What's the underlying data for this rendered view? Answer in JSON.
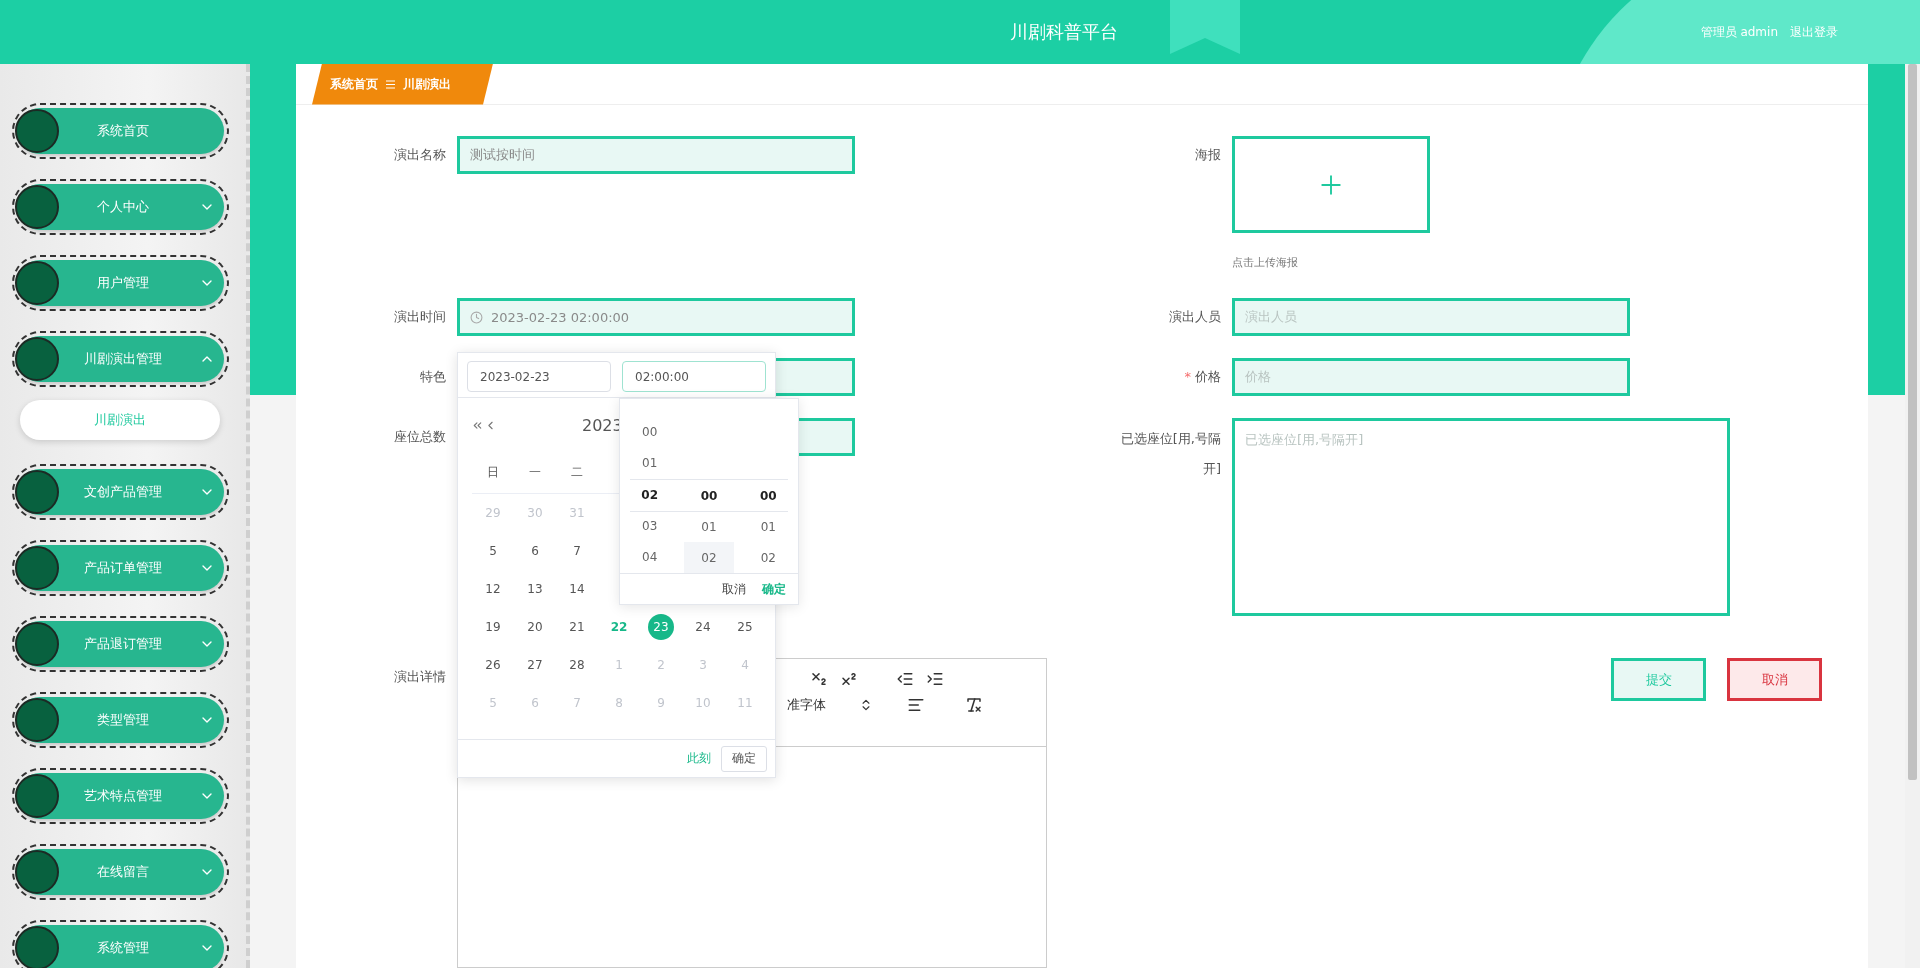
{
  "header": {
    "title": "川剧科普平台",
    "user": "管理员 admin",
    "logout": "退出登录"
  },
  "sidebar": {
    "items": [
      {
        "label": "系统首页",
        "kind": "link"
      },
      {
        "label": "个人中心",
        "kind": "group",
        "expanded": false
      },
      {
        "label": "用户管理",
        "kind": "group",
        "expanded": false
      },
      {
        "label": "川剧演出管理",
        "kind": "group",
        "expanded": true,
        "children": [
          {
            "label": "川剧演出",
            "selected": true
          }
        ]
      },
      {
        "label": "文创产品管理",
        "kind": "group",
        "expanded": false
      },
      {
        "label": "产品订单管理",
        "kind": "group",
        "expanded": false
      },
      {
        "label": "产品退订管理",
        "kind": "group",
        "expanded": false
      },
      {
        "label": "类型管理",
        "kind": "group",
        "expanded": false
      },
      {
        "label": "艺术特点管理",
        "kind": "group",
        "expanded": false
      },
      {
        "label": "在线留言",
        "kind": "group",
        "expanded": false
      },
      {
        "label": "系统管理",
        "kind": "group",
        "expanded": false
      }
    ]
  },
  "breadcrumb": [
    "系统首页",
    "川剧演出"
  ],
  "form": {
    "left": [
      {
        "label": "演出名称",
        "kind": "input",
        "value": "测试按时间"
      },
      {
        "label": "演出时间",
        "kind": "datetime",
        "value": "2023-02-23 02:00:00"
      },
      {
        "label": "特色",
        "kind": "input"
      },
      {
        "label": "座位总数",
        "kind": "input"
      },
      {
        "label": "演出详情",
        "kind": "editor"
      }
    ],
    "right": [
      {
        "label": "海报",
        "kind": "upload",
        "hint": "点击上传海报",
        "required": false
      },
      {
        "label": "演出人员",
        "kind": "input",
        "placeholder": "演出人员",
        "required": false
      },
      {
        "label": "价格",
        "kind": "input",
        "placeholder": "价格",
        "required": true
      },
      {
        "label": "已选座位[用,号隔开]",
        "kind": "textarea",
        "placeholder": "已选座位[用,号隔开]",
        "required": false
      }
    ],
    "buttons": [
      {
        "label": "提交",
        "kind": "submit"
      },
      {
        "label": "取消",
        "kind": "cancel"
      }
    ],
    "editor_toolbar": {
      "font_select": "准字体"
    },
    "required_mark": "*"
  },
  "date_picker": {
    "date_input": "2023-02-23",
    "time_input": "02:00:00",
    "month_title": "2023",
    "weekdays": [
      "日",
      "一",
      "二"
    ],
    "weeks": [
      [
        {
          "day": "29",
          "muted": true,
          "today": false,
          "selected": false
        },
        {
          "day": "30",
          "muted": true,
          "today": false,
          "selected": false
        },
        {
          "day": "31",
          "muted": true,
          "today": false,
          "selected": false
        }
      ],
      [
        {
          "day": "5",
          "muted": false,
          "today": false,
          "selected": false
        },
        {
          "day": "6",
          "muted": false,
          "today": false,
          "selected": false
        },
        {
          "day": "7",
          "muted": false,
          "today": false,
          "selected": false
        }
      ],
      [
        {
          "day": "12",
          "muted": false,
          "today": false,
          "selected": false
        },
        {
          "day": "13",
          "muted": false,
          "today": false,
          "selected": false
        },
        {
          "day": "14",
          "muted": false,
          "today": false,
          "selected": false
        }
      ],
      [
        {
          "day": "19",
          "muted": false,
          "today": false,
          "selected": false
        },
        {
          "day": "20",
          "muted": false,
          "today": false,
          "selected": false
        },
        {
          "day": "21",
          "muted": false,
          "today": false,
          "selected": false
        },
        {
          "day": "22",
          "muted": false,
          "today": true,
          "selected": false
        },
        {
          "day": "23",
          "muted": false,
          "today": false,
          "selected": true
        },
        {
          "day": "24",
          "muted": false,
          "today": false,
          "selected": false
        },
        {
          "day": "25",
          "muted": false,
          "today": false,
          "selected": false
        }
      ],
      [
        {
          "day": "26",
          "muted": false,
          "today": false,
          "selected": false
        },
        {
          "day": "27",
          "muted": false,
          "today": false,
          "selected": false
        },
        {
          "day": "28",
          "muted": false,
          "today": false,
          "selected": false
        },
        {
          "day": "1",
          "muted": true,
          "today": false,
          "selected": false
        },
        {
          "day": "2",
          "muted": true,
          "today": false,
          "selected": false
        },
        {
          "day": "3",
          "muted": true,
          "today": false,
          "selected": false
        },
        {
          "day": "4",
          "muted": true,
          "today": false,
          "selected": false
        }
      ],
      [
        {
          "day": "5",
          "muted": true,
          "today": false,
          "selected": false
        },
        {
          "day": "6",
          "muted": true,
          "today": false,
          "selected": false
        },
        {
          "day": "7",
          "muted": true,
          "today": false,
          "selected": false
        },
        {
          "day": "8",
          "muted": true,
          "today": false,
          "selected": false
        },
        {
          "day": "9",
          "muted": true,
          "today": false,
          "selected": false
        },
        {
          "day": "10",
          "muted": true,
          "today": false,
          "selected": false
        },
        {
          "day": "11",
          "muted": true,
          "today": false,
          "selected": false
        }
      ]
    ],
    "now_link": "此刻",
    "confirm": "确定",
    "time_panel": {
      "columns": [
        [
          {
            "text": "00",
            "selected": false,
            "hovered": false
          },
          {
            "text": "01",
            "selected": false,
            "hovered": false
          },
          {
            "text": "02",
            "selected": true,
            "hovered": false
          },
          {
            "text": "03",
            "selected": false,
            "hovered": false
          },
          {
            "text": "04",
            "selected": false,
            "hovered": false
          }
        ],
        [
          {
            "text": "00",
            "selected": true,
            "hovered": false
          },
          {
            "text": "01",
            "selected": false,
            "hovered": false
          },
          {
            "text": "02",
            "selected": false,
            "hovered": true
          }
        ],
        [
          {
            "text": "00",
            "selected": true,
            "hovered": false
          },
          {
            "text": "01",
            "selected": false,
            "hovered": false
          },
          {
            "text": "02",
            "selected": false,
            "hovered": false
          }
        ]
      ],
      "cancel": "取消",
      "confirm": "确定"
    }
  }
}
